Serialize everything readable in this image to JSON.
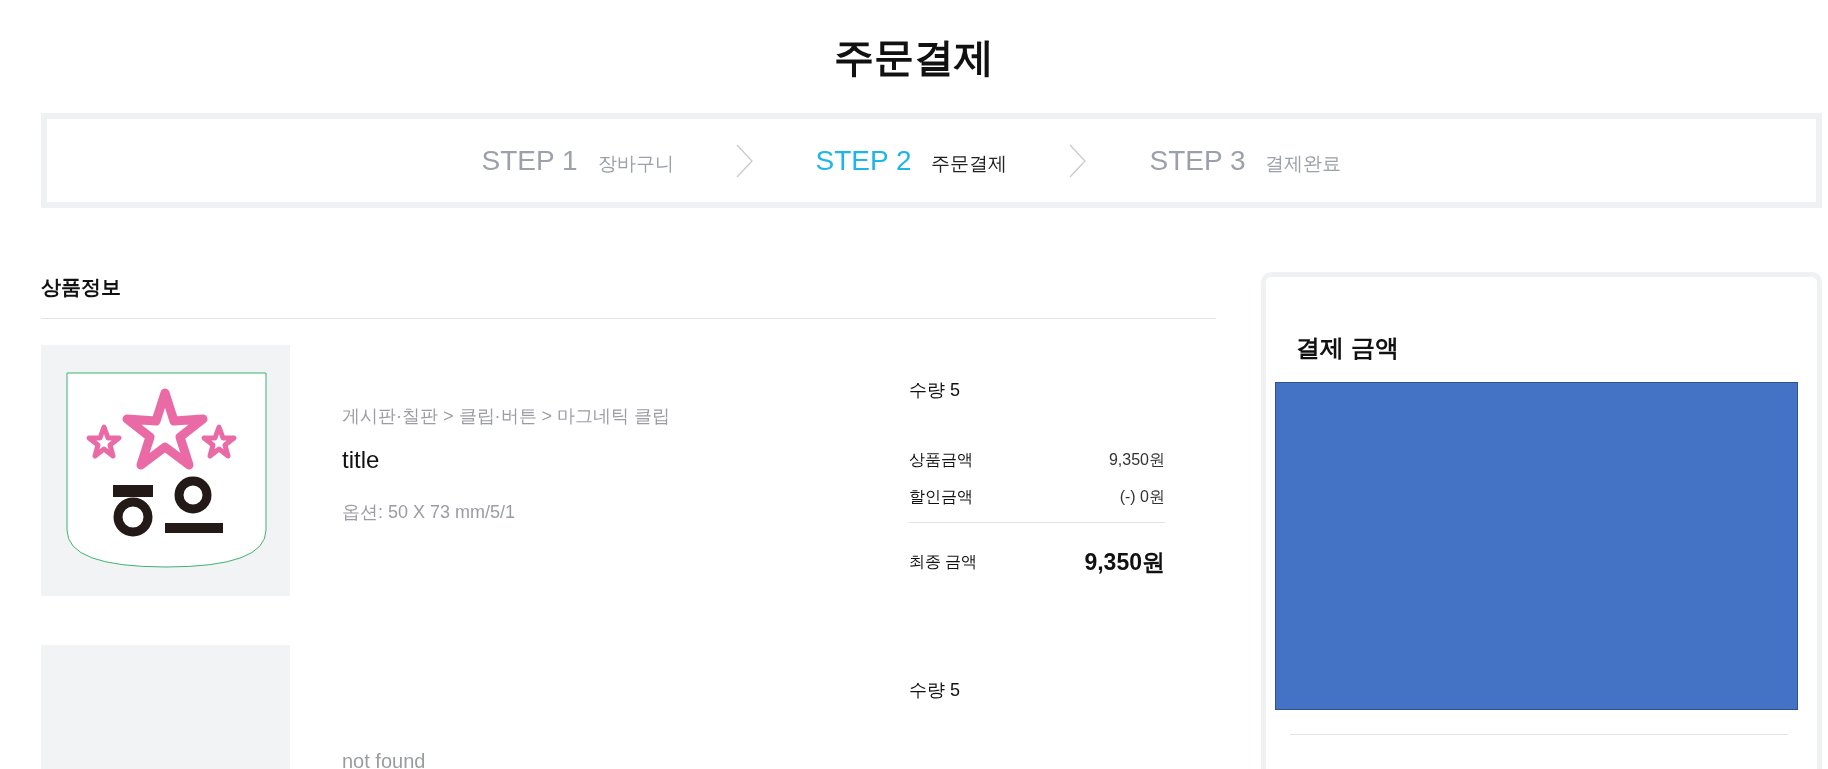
{
  "page_title": "주문결제",
  "steps": [
    {
      "step": "STEP 1",
      "label": "장바구니",
      "selected": false
    },
    {
      "step": "STEP 2",
      "label": "주문결제",
      "selected": true
    },
    {
      "step": "STEP 3",
      "label": "결제완료",
      "selected": false
    }
  ],
  "products": {
    "heading": "상품정보",
    "items": [
      {
        "category": "게시판·칠판 > 클립·버튼 > 마그네틱 클립",
        "title": "title",
        "option": "옵션: 50 X 73 mm/5/1",
        "quantity": "수량 5",
        "price_label": "상품금액",
        "price": "9,350원",
        "discount_label": "할인금액",
        "discount": "(-) 0원",
        "total_label": "최종 금액",
        "total": "9,350원"
      },
      {
        "image": {
          "kind": "empty"
        },
        "title": "not found",
        "quantity": "수량 5"
      }
    ]
  },
  "payment": {
    "heading": "결제 금액"
  }
}
